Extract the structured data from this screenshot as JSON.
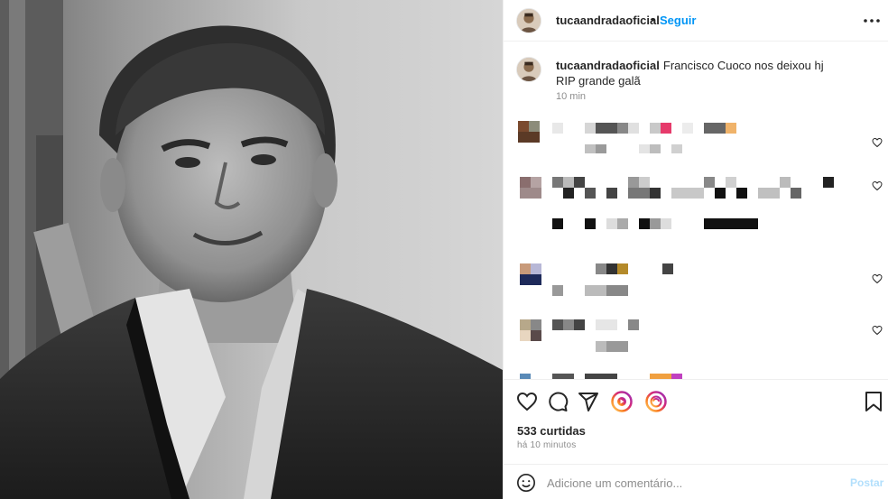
{
  "header": {
    "username": "tucaandradaoficial",
    "separator": "•",
    "follow_label": "Seguir",
    "more_icon": "more-horizontal-icon"
  },
  "caption": {
    "username": "tucaandradaoficial",
    "text": "Francisco Cuoco nos deixou hj\nRIP grande galã",
    "time": "10 min"
  },
  "actions": {
    "icons": [
      "heart-icon",
      "comment-icon",
      "share-icon",
      "reels-icon",
      "reels-icon",
      "bookmark-icon"
    ],
    "likes": "533 curtidas",
    "time": "há 10 minutos"
  },
  "comment_box": {
    "placeholder": "Adicione um comentário...",
    "post_label": "Postar"
  },
  "colors": {
    "accent": "#0095f6",
    "post_disabled": "#b2dffc",
    "muted": "#8e8e8e",
    "border": "#efefef"
  }
}
